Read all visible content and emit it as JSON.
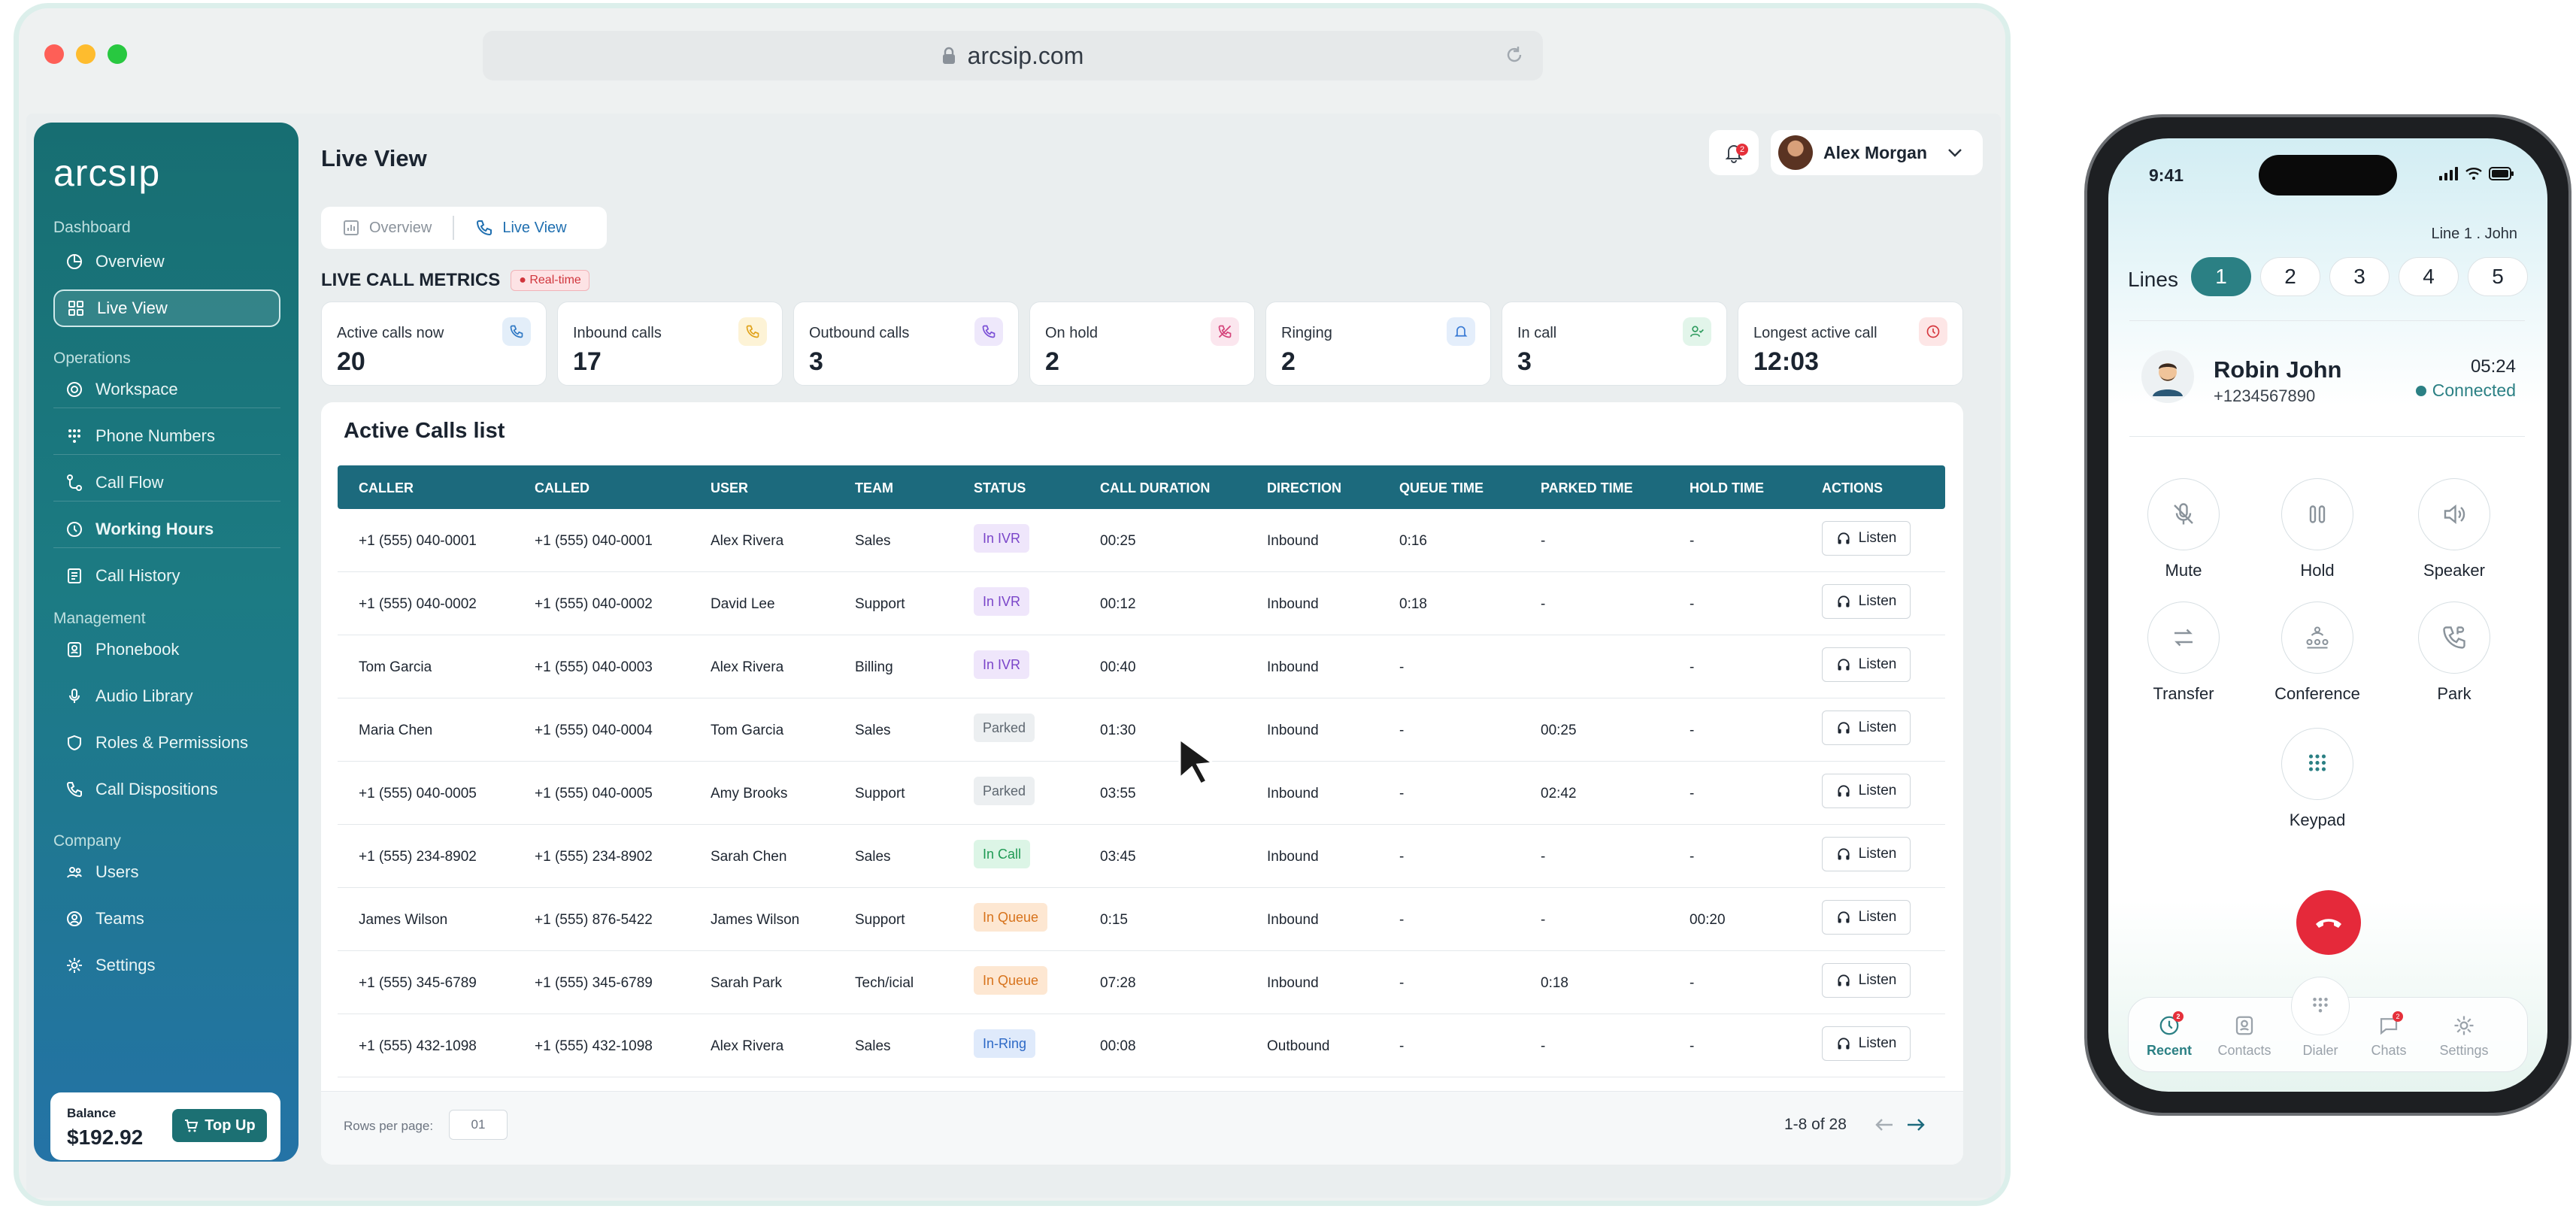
{
  "browser": {
    "url": "arcsip.com"
  },
  "sidebar": {
    "logo": "arcsıp",
    "sections": {
      "dashboard": "Dashboard",
      "operations": "Operations",
      "management": "Management",
      "company": "Company"
    },
    "items": [
      {
        "label": "Overview",
        "icon": "pie-chart-icon"
      },
      {
        "label": "Live View",
        "icon": "grid-icon"
      },
      {
        "label": "Workspace",
        "icon": "target-icon"
      },
      {
        "label": "Phone Numbers",
        "icon": "dialpad-icon"
      },
      {
        "label": "Call Flow",
        "icon": "flow-icon"
      },
      {
        "label": "Working Hours",
        "icon": "clock-icon"
      },
      {
        "label": "Call History",
        "icon": "history-icon"
      },
      {
        "label": "Phonebook",
        "icon": "contacts-icon"
      },
      {
        "label": "Audio Library",
        "icon": "mic-icon"
      },
      {
        "label": "Roles & Permissions",
        "icon": "shield-icon"
      },
      {
        "label": "Call Dispositions",
        "icon": "phone-icon"
      },
      {
        "label": "Users",
        "icon": "users-icon"
      },
      {
        "label": "Teams",
        "icon": "teams-icon"
      },
      {
        "label": "Settings",
        "icon": "gear-icon"
      }
    ],
    "balance": {
      "label": "Balance",
      "value": "$192.92",
      "topup": "Top Up"
    }
  },
  "header": {
    "title": "Live View",
    "notifications": "2",
    "user": "Alex Morgan"
  },
  "tabs": [
    "Overview",
    "Live View"
  ],
  "metrics": {
    "heading": "LIVE CALL METRICS",
    "badge": "Real-time",
    "cards": [
      {
        "label": "Active calls now",
        "value": "20",
        "color": "#e3eef9",
        "icolor": "#2f78c4"
      },
      {
        "label": "Inbound calls",
        "value": "17",
        "color": "#fdf3d6",
        "icolor": "#e0a21a"
      },
      {
        "label": "Outbound calls",
        "value": "3",
        "color": "#eee8fb",
        "icolor": "#7a4fd6"
      },
      {
        "label": "On hold",
        "value": "2",
        "color": "#fbe6ee",
        "icolor": "#d4437a"
      },
      {
        "label": "Ringing",
        "value": "2",
        "color": "#e4eefb",
        "icolor": "#3a7bd5"
      },
      {
        "label": "In call",
        "value": "3",
        "color": "#e2f5ea",
        "icolor": "#2e9b5e"
      },
      {
        "label": "Longest active call",
        "value": "12:03",
        "color": "#fde6e6",
        "icolor": "#d6383f"
      }
    ]
  },
  "table": {
    "title": "Active Calls list",
    "columns": [
      "CALLER",
      "CALLED",
      "USER",
      "TEAM",
      "STATUS",
      "CALL DURATION",
      "DIRECTION",
      "QUEUE TIME",
      "PARKED TIME",
      "HOLD TIME",
      "ACTIONS"
    ],
    "rows": [
      [
        "+1 (555) 040-0001",
        "+1 (555) 040-0001",
        "Alex Rivera",
        "Sales",
        "In IVR",
        "00:25",
        "Inbound",
        "0:16",
        "-",
        "-",
        "Listen"
      ],
      [
        "+1 (555) 040-0002",
        "+1 (555) 040-0002",
        "David Lee",
        "Support",
        "In IVR",
        "00:12",
        "Inbound",
        "0:18",
        "-",
        "-",
        "Listen"
      ],
      [
        "Tom Garcia",
        "+1 (555) 040-0003",
        "Alex Rivera",
        "Billing",
        "In IVR",
        "00:40",
        "Inbound",
        "-",
        "",
        "-",
        "Listen"
      ],
      [
        "Maria Chen",
        "+1 (555) 040-0004",
        "Tom Garcia",
        "Sales",
        "Parked",
        "01:30",
        "Inbound",
        "-",
        "00:25",
        "-",
        "Listen"
      ],
      [
        "+1 (555) 040-0005",
        "+1 (555) 040-0005",
        "Amy Brooks",
        "Support",
        "Parked",
        "03:55",
        "Inbound",
        "-",
        "02:42",
        "-",
        "Listen"
      ],
      [
        "+1 (555) 234-8902",
        "+1 (555) 234-8902",
        "Sarah Chen",
        "Sales",
        "In Call",
        "03:45",
        "Inbound",
        "-",
        "-",
        "-",
        "Listen"
      ],
      [
        "James Wilson",
        "+1 (555) 876-5422",
        "James Wilson",
        "Support",
        "In Queue",
        "0:15",
        "Inbound",
        "-",
        "-",
        "00:20",
        "Listen"
      ],
      [
        "+1 (555) 345-6789",
        "+1 (555) 345-6789",
        "Sarah Park",
        "Tech/icial",
        "In Queue",
        "07:28",
        "Inbound",
        "-",
        "0:18",
        "-",
        "Listen"
      ],
      [
        "+1 (555) 432-1098",
        "+1 (555) 432-1098",
        "Alex Rivera",
        "Sales",
        "In-Ring",
        "00:08",
        "Outbound",
        "-",
        "-",
        "-",
        "Listen"
      ]
    ],
    "status_colors": {
      "In IVR": {
        "bg": "#efe6fb",
        "fg": "#7a45c9"
      },
      "Parked": {
        "bg": "#eceff1",
        "fg": "#5e6770"
      },
      "In Call": {
        "bg": "#dcf5e6",
        "fg": "#1f9a54"
      },
      "In Queue": {
        "bg": "#fde7d2",
        "fg": "#d7731c"
      },
      "In-Ring": {
        "bg": "#dfeafb",
        "fg": "#2d69c6"
      }
    },
    "footer": {
      "rows_per_page_label": "Rows per page:",
      "rows_per_page": "01",
      "pagination": "1-8 of 28"
    }
  },
  "phone": {
    "time": "9:41",
    "line_info": "Line 1 . John",
    "lines_label": "Lines",
    "lines": [
      "1",
      "2",
      "3",
      "4",
      "5"
    ],
    "caller": {
      "name": "Robin John",
      "number": "+1234567890",
      "duration": "05:24",
      "status": "Connected"
    },
    "actions": [
      "Mute",
      "Hold",
      "Speaker",
      "Transfer",
      "Conference",
      "Park",
      "Keypad"
    ],
    "tabs": [
      "Recent",
      "Contacts",
      "Dialer",
      "Chats",
      "Settings"
    ],
    "recent_badge": "2",
    "chats_badge": "2"
  }
}
